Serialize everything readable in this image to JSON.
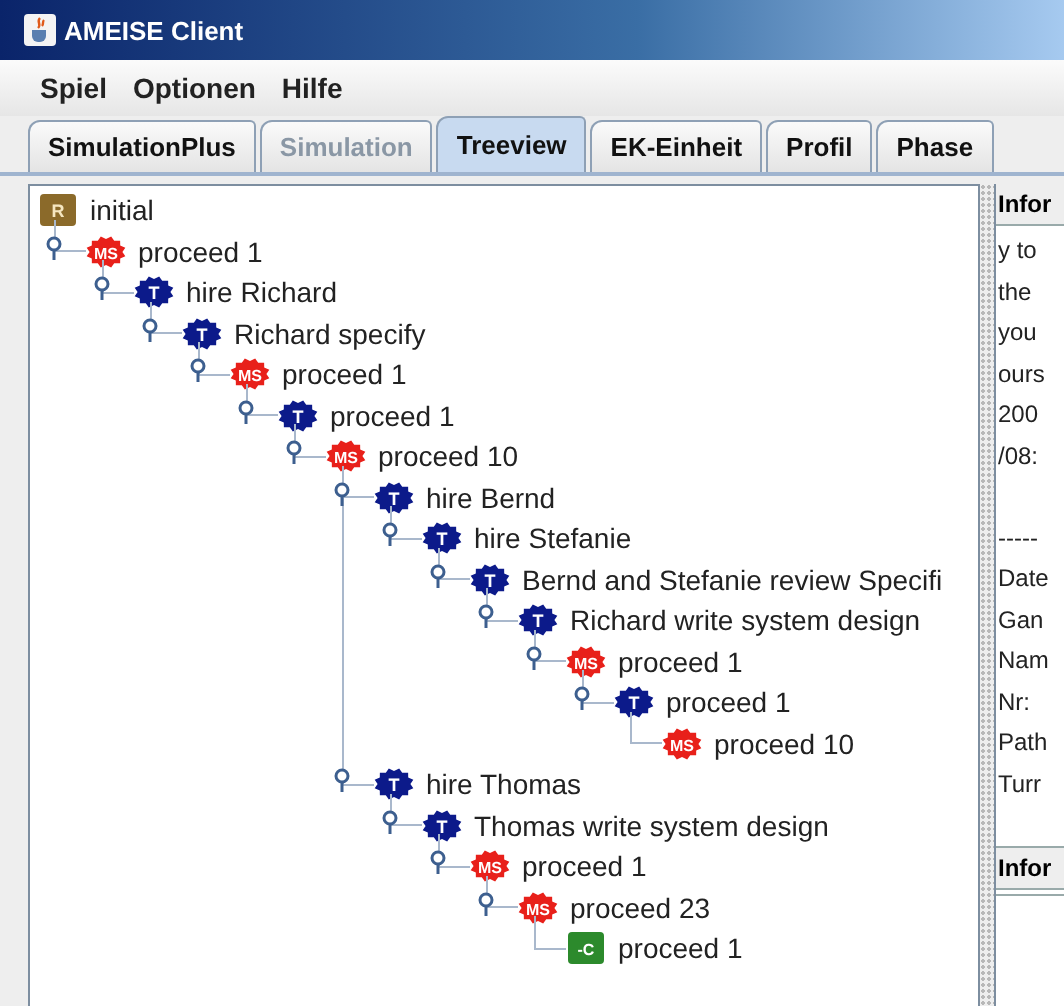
{
  "window": {
    "title": "AMEISE Client"
  },
  "menu": [
    "Spiel",
    "Optionen",
    "Hilfe"
  ],
  "tabs": [
    {
      "label": "SimulationPlus",
      "selected": false,
      "disabled": false
    },
    {
      "label": "Simulation",
      "selected": false,
      "disabled": true
    },
    {
      "label": "Treeview",
      "selected": true,
      "disabled": false
    },
    {
      "label": "EK-Einheit",
      "selected": false,
      "disabled": false
    },
    {
      "label": "Profil",
      "selected": false,
      "disabled": false
    },
    {
      "label": "Phase",
      "selected": false,
      "disabled": false
    }
  ],
  "tree": {
    "kind": "root",
    "badge": "R",
    "label": "initial",
    "children": [
      {
        "kind": "milestone",
        "badge": "MS",
        "label": "proceed 1",
        "children": [
          {
            "kind": "task",
            "badge": "T",
            "label": "hire Richard",
            "children": [
              {
                "kind": "task",
                "badge": "T",
                "label": "Richard specify",
                "children": [
                  {
                    "kind": "milestone",
                    "badge": "MS",
                    "label": "proceed 1",
                    "children": [
                      {
                        "kind": "task",
                        "badge": "T",
                        "label": "proceed 1",
                        "children": [
                          {
                            "kind": "milestone",
                            "badge": "MS",
                            "label": "proceed 10",
                            "children": [
                              {
                                "kind": "task",
                                "badge": "T",
                                "label": "hire Bernd",
                                "children": [
                                  {
                                    "kind": "task",
                                    "badge": "T",
                                    "label": "hire Stefanie",
                                    "children": [
                                      {
                                        "kind": "task",
                                        "badge": "T",
                                        "label": "Bernd and  Stefanie review Specifi",
                                        "children": [
                                          {
                                            "kind": "task",
                                            "badge": "T",
                                            "label": "Richard write system design",
                                            "children": [
                                              {
                                                "kind": "milestone",
                                                "badge": "MS",
                                                "label": "proceed 1",
                                                "children": [
                                                  {
                                                    "kind": "task",
                                                    "badge": "T",
                                                    "label": "proceed 1",
                                                    "children": [
                                                      {
                                                        "kind": "milestone",
                                                        "badge": "MS",
                                                        "label": "proceed 10"
                                                      }
                                                    ]
                                                  }
                                                ]
                                              }
                                            ]
                                          }
                                        ]
                                      }
                                    ]
                                  }
                                ]
                              },
                              {
                                "kind": "task",
                                "badge": "T",
                                "label": "hire Thomas",
                                "children": [
                                  {
                                    "kind": "task",
                                    "badge": "T",
                                    "label": "Thomas write system design",
                                    "children": [
                                      {
                                        "kind": "milestone",
                                        "badge": "MS",
                                        "label": "proceed 1",
                                        "children": [
                                          {
                                            "kind": "milestone",
                                            "badge": "MS",
                                            "label": "proceed 23",
                                            "children": [
                                              {
                                                "kind": "check",
                                                "badge": "-C",
                                                "label": "proceed 1"
                                              }
                                            ]
                                          }
                                        ]
                                      }
                                    ]
                                  }
                                ]
                              }
                            ]
                          }
                        ]
                      }
                    ]
                  }
                ]
              }
            ]
          }
        ]
      }
    ]
  },
  "info_panel": {
    "sections": [
      {
        "heading": "Infor",
        "blocks": [
          [
            "y to",
            "the",
            "you",
            "ours",
            "200",
            "/08:"
          ],
          [
            "-----",
            "Date",
            "Gan",
            "Nam",
            "Nr:",
            "Path",
            "Turr"
          ]
        ]
      },
      {
        "heading": "Infor"
      }
    ]
  }
}
